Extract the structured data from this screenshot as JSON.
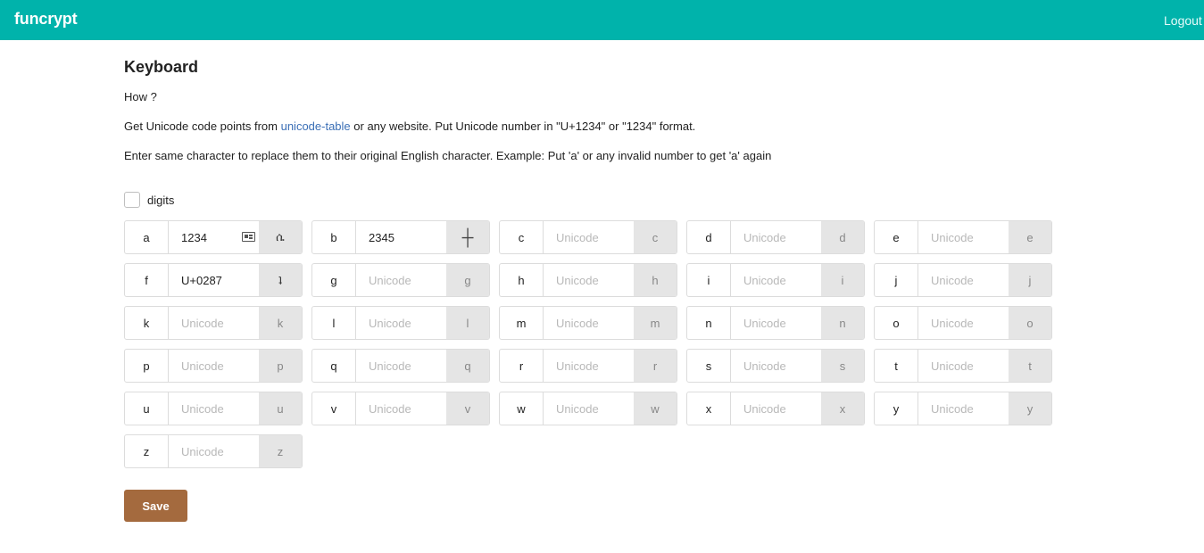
{
  "app": {
    "brand": "funcrypt",
    "logout": "Logout"
  },
  "page": {
    "title": "Keyboard",
    "how": "How ?",
    "instructions_prefix": "Get Unicode code points from ",
    "instructions_link": "unicode-table",
    "instructions_suffix": " or any website. Put Unicode number in \"U+1234\" or \"1234\" format.",
    "replace_note": "Enter same character to replace them to their original English character. Example: Put 'a' or any invalid number to get 'a' again"
  },
  "digits": {
    "label": "digits",
    "checked": false
  },
  "placeholder": "Unicode",
  "keys": [
    {
      "letter": "a",
      "value": "1234",
      "preview": "ሴ",
      "icon": "contact-card-icon"
    },
    {
      "letter": "b",
      "value": "2345",
      "preview": "┼"
    },
    {
      "letter": "c",
      "value": "",
      "preview": "c"
    },
    {
      "letter": "d",
      "value": "",
      "preview": "d"
    },
    {
      "letter": "e",
      "value": "",
      "preview": "e"
    },
    {
      "letter": "f",
      "value": "U+0287",
      "preview": "ʇ"
    },
    {
      "letter": "g",
      "value": "",
      "preview": "g"
    },
    {
      "letter": "h",
      "value": "",
      "preview": "h"
    },
    {
      "letter": "i",
      "value": "",
      "preview": "i"
    },
    {
      "letter": "j",
      "value": "",
      "preview": "j"
    },
    {
      "letter": "k",
      "value": "",
      "preview": "k"
    },
    {
      "letter": "l",
      "value": "",
      "preview": "l"
    },
    {
      "letter": "m",
      "value": "",
      "preview": "m"
    },
    {
      "letter": "n",
      "value": "",
      "preview": "n"
    },
    {
      "letter": "o",
      "value": "",
      "preview": "o"
    },
    {
      "letter": "p",
      "value": "",
      "preview": "p"
    },
    {
      "letter": "q",
      "value": "",
      "preview": "q"
    },
    {
      "letter": "r",
      "value": "",
      "preview": "r"
    },
    {
      "letter": "s",
      "value": "",
      "preview": "s"
    },
    {
      "letter": "t",
      "value": "",
      "preview": "t"
    },
    {
      "letter": "u",
      "value": "",
      "preview": "u"
    },
    {
      "letter": "v",
      "value": "",
      "preview": "v"
    },
    {
      "letter": "w",
      "value": "",
      "preview": "w"
    },
    {
      "letter": "x",
      "value": "",
      "preview": "x"
    },
    {
      "letter": "y",
      "value": "",
      "preview": "y"
    },
    {
      "letter": "z",
      "value": "",
      "preview": "z"
    }
  ],
  "save_label": "Save",
  "colors": {
    "navbar": "#00b3ab",
    "save_button": "#a46a3e",
    "link": "#3b6fb6"
  }
}
